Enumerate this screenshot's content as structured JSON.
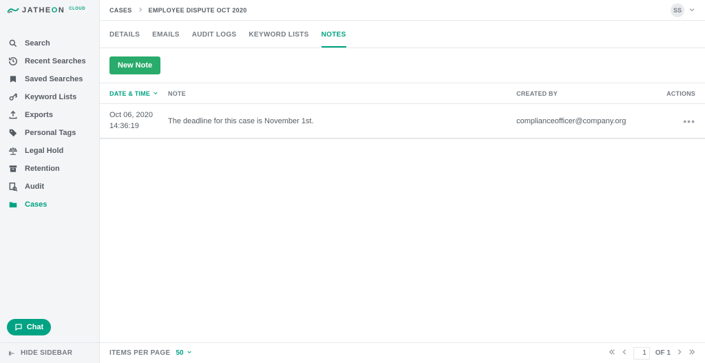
{
  "brand": {
    "text_main": "JATHE",
    "text_teal": "O",
    "text_main2": "N",
    "cloud": "CLOUD"
  },
  "sidebar": {
    "items": [
      {
        "label": "Search",
        "icon": "search"
      },
      {
        "label": "Recent Searches",
        "icon": "history"
      },
      {
        "label": "Saved Searches",
        "icon": "bookmark"
      },
      {
        "label": "Keyword Lists",
        "icon": "key"
      },
      {
        "label": "Exports",
        "icon": "upload"
      },
      {
        "label": "Personal Tags",
        "icon": "tag"
      },
      {
        "label": "Legal Hold",
        "icon": "scales"
      },
      {
        "label": "Retention",
        "icon": "archive"
      },
      {
        "label": "Audit",
        "icon": "audit"
      },
      {
        "label": "Cases",
        "icon": "folder",
        "active": true
      }
    ],
    "chat": "Chat",
    "hide": "HIDE SIDEBAR"
  },
  "breadcrumb": {
    "root": "CASES",
    "current": "EMPLOYEE DISPUTE OCT 2020"
  },
  "user": {
    "initials": "SS"
  },
  "tabs": [
    {
      "label": "DETAILS"
    },
    {
      "label": "EMAILS"
    },
    {
      "label": "AUDIT LOGS"
    },
    {
      "label": "KEYWORD LISTS"
    },
    {
      "label": "NOTES",
      "active": true
    }
  ],
  "buttons": {
    "new_note": "New Note"
  },
  "table": {
    "headers": {
      "date": "DATE & TIME",
      "note": "NOTE",
      "created_by": "CREATED BY",
      "actions": "ACTIONS"
    },
    "rows": [
      {
        "date": "Oct 06, 2020",
        "time": "14:36:19",
        "note": "The deadline for this case is November 1st.",
        "created_by": "complianceofficer@company.org"
      }
    ]
  },
  "footer": {
    "ipp_label": "ITEMS PER PAGE",
    "ipp_value": "50",
    "page_current": "1",
    "page_total": "1",
    "of_label": "OF"
  }
}
